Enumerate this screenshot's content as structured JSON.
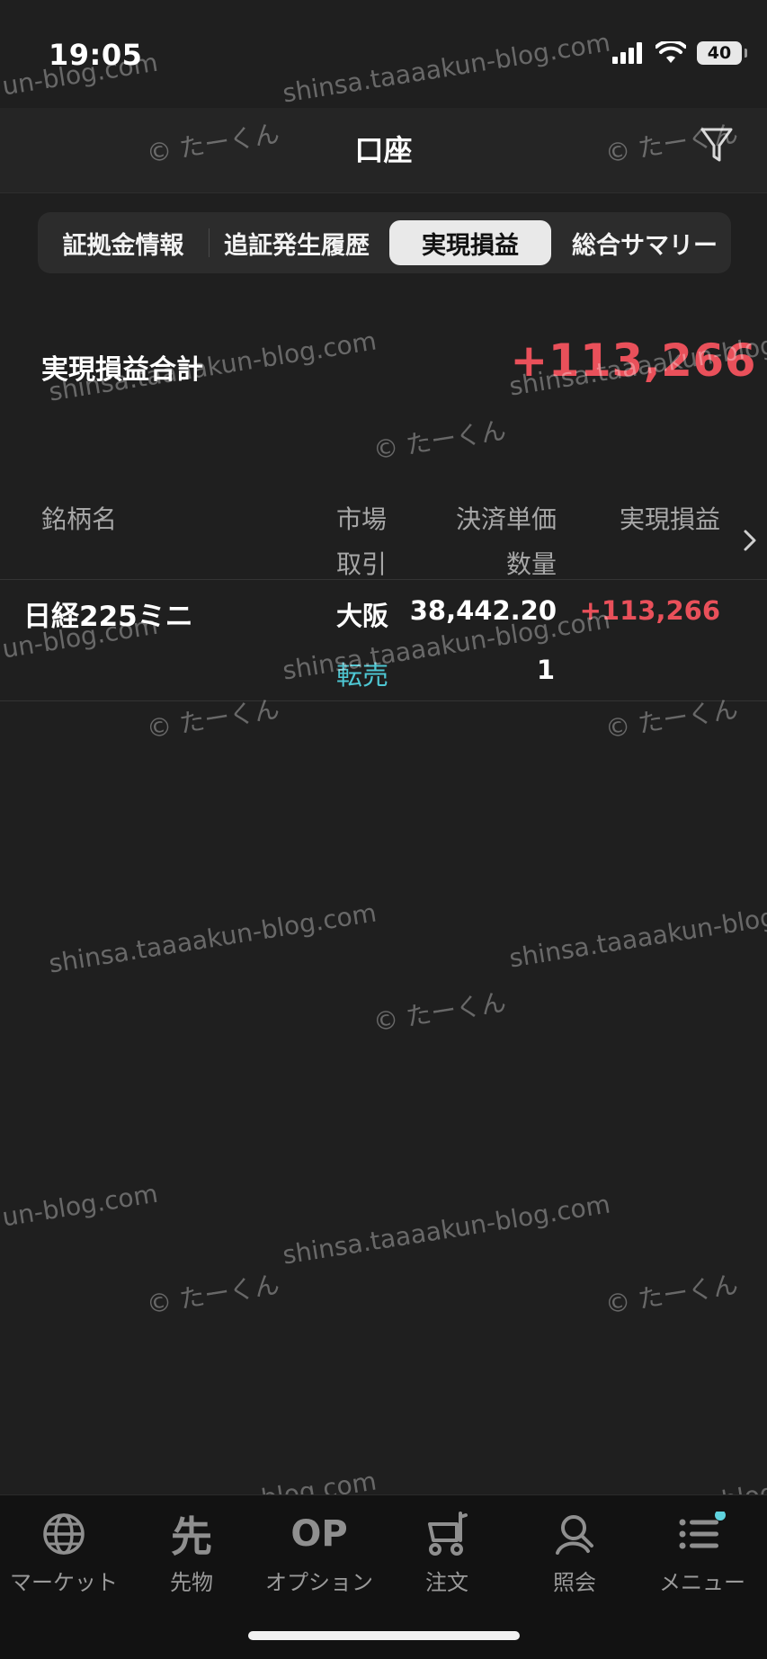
{
  "status": {
    "time": "19:05",
    "battery": "40"
  },
  "header": {
    "title": "口座",
    "filter_icon": "filter-icon"
  },
  "tabs": [
    {
      "label": "証拠金情報",
      "active": false
    },
    {
      "label": "追証発生履歴",
      "active": false
    },
    {
      "label": "実現損益",
      "active": true
    },
    {
      "label": "総合サマリー",
      "active": false
    }
  ],
  "summary": {
    "label": "実現損益合計",
    "value": "+113,266"
  },
  "table": {
    "headers": {
      "name": "銘柄名",
      "market": "市場",
      "trade": "取引",
      "price": "決済単価",
      "qty": "数量",
      "pl": "実現損益"
    },
    "rows": [
      {
        "name": "日経225ミニ",
        "market": "大阪",
        "price": "38,442.20",
        "pl": "+113,266",
        "trade": "転売",
        "qty": "1"
      }
    ]
  },
  "watermark": {
    "text1": "shinsa.taaaakun-blog.com",
    "text2": "© たーくん",
    "text3": "un-blog.com"
  },
  "nav": [
    {
      "label": "マーケット",
      "icon": "globe-icon",
      "active": false
    },
    {
      "label": "先物",
      "icon": "futures-icon",
      "glyph": "先",
      "active": false
    },
    {
      "label": "オプション",
      "icon": "option-icon",
      "glyph": "OP",
      "active": false
    },
    {
      "label": "注文",
      "icon": "cart-icon",
      "active": false
    },
    {
      "label": "照会",
      "icon": "person-search-icon",
      "active": false
    },
    {
      "label": "メニュー",
      "icon": "menu-icon",
      "active": true
    }
  ],
  "colors": {
    "profit": "#e9505a",
    "teal": "#4ec7d3",
    "accent_dot": "#5fd3de"
  }
}
